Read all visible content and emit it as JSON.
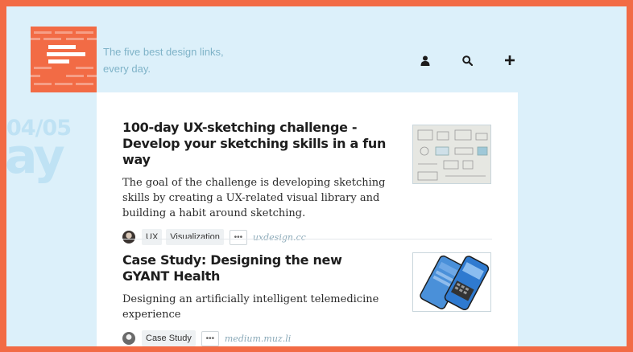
{
  "header": {
    "tagline": "The five best design links, every day.",
    "icons": [
      "user-icon",
      "search-icon",
      "plus-icon"
    ]
  },
  "date": {
    "number": "04/05",
    "word": "ay"
  },
  "articles": [
    {
      "title": "100-day UX-sketching challenge - Develop your sketching skills in a fun way",
      "description": "The goal of the challenge is developing sketching skills by creating a UX-related visual library and building a habit around sketching.",
      "tags": [
        "UX",
        "Visualization"
      ],
      "more": "•••",
      "source": "uxdesign.cc"
    },
    {
      "title": "Case Study: Designing the new GYANT Health",
      "description": "Designing an artificially intelligent telemedicine experience",
      "tags": [
        "Case Study"
      ],
      "more": "•••",
      "source": "medium.muz.li"
    }
  ],
  "colors": {
    "brand": "#f26b45",
    "background": "#dcf0fa",
    "card": "#ffffff",
    "muted": "#8aa9b8"
  }
}
